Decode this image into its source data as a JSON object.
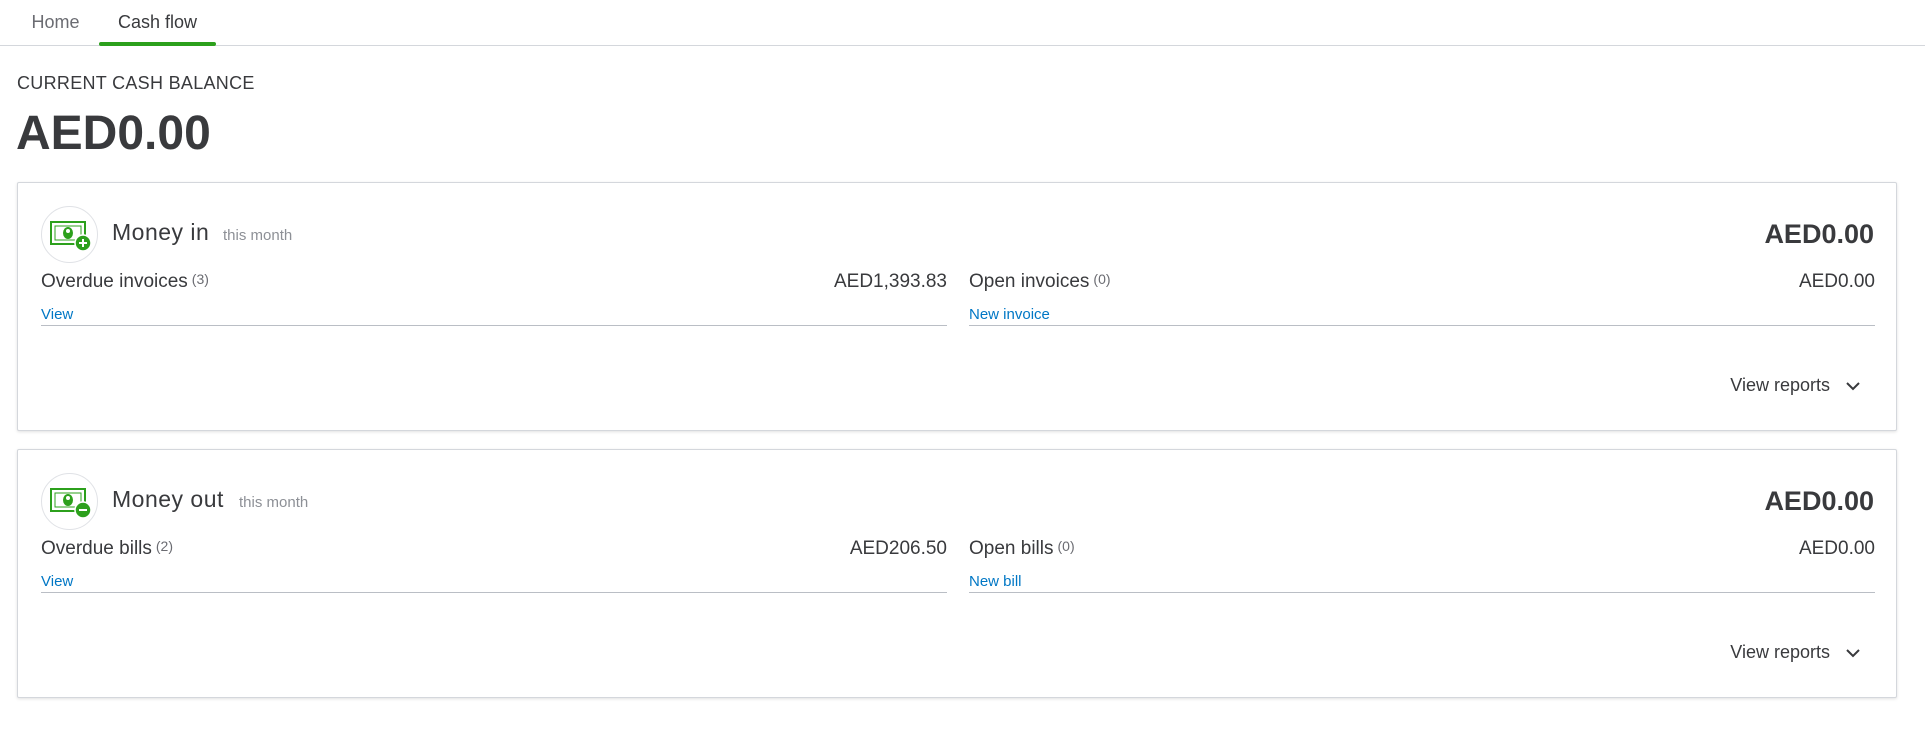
{
  "tabs": [
    {
      "label": "Home",
      "active": false
    },
    {
      "label": "Cash flow",
      "active": true
    }
  ],
  "balance": {
    "label": "CURRENT CASH BALANCE",
    "value": "AED0.00"
  },
  "money_in": {
    "title": "Money in",
    "subtitle": "this month",
    "total": "AED0.00",
    "icon": "money-in-icon",
    "left": {
      "label": "Overdue invoices",
      "count": "(3)",
      "amount": "AED1,393.83",
      "link": "View"
    },
    "right": {
      "label": "Open invoices",
      "count": "(0)",
      "amount": "AED0.00",
      "link": "New invoice"
    },
    "view_reports": "View reports"
  },
  "money_out": {
    "title": "Money out",
    "subtitle": "this month",
    "total": "AED0.00",
    "icon": "money-out-icon",
    "left": {
      "label": "Overdue bills",
      "count": "(2)",
      "amount": "AED206.50",
      "link": "View"
    },
    "right": {
      "label": "Open bills",
      "count": "(0)",
      "amount": "AED0.00",
      "link": "New bill"
    },
    "view_reports": "View reports"
  },
  "colors": {
    "accent_green": "#2ca01c",
    "link_blue": "#0077c5",
    "text_dark": "#393a3d"
  }
}
